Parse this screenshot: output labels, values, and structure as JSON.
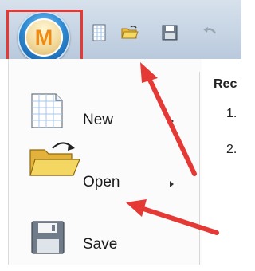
{
  "menu": {
    "new_label": "New",
    "open_label": "Open",
    "save_label": "Save"
  },
  "recent": {
    "header": "Rec",
    "items": [
      "1.",
      "2."
    ]
  },
  "app_logo": {
    "letter": "M"
  },
  "colors": {
    "highlight": "#e53935",
    "orb_blue": "#2e8bd2",
    "folder_yellow": "#f2cf4a"
  },
  "icons": {
    "orb": "app-menu-orb-icon",
    "new": "new-document-icon",
    "open": "open-folder-icon",
    "save": "floppy-disk-icon",
    "undo": "undo-icon"
  }
}
